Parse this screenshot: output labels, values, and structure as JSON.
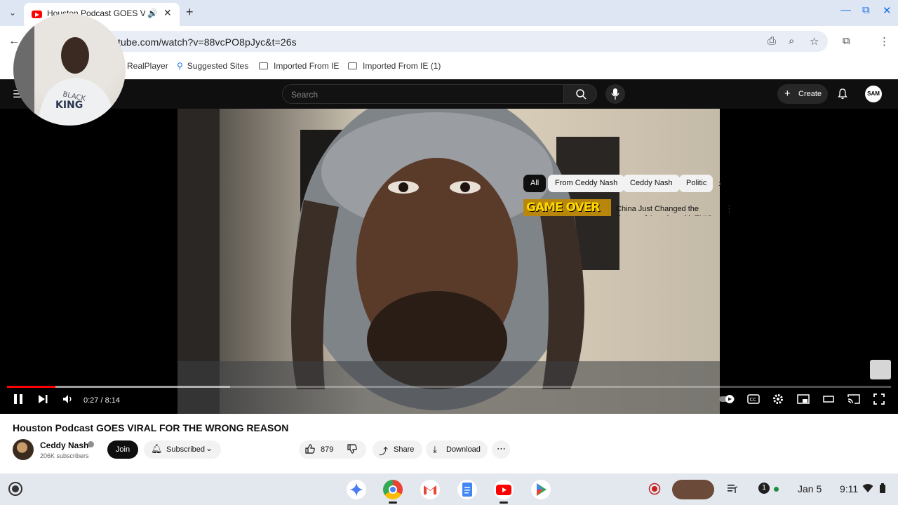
{
  "browser": {
    "tab_title": "Houston Podcast GOES VI",
    "url_prefix": "youtube.com",
    "url_visible": "tube.com/watch?v=88vcPO8pJyc&t=26s",
    "bookmarks": [
      {
        "label": "RealPlayer"
      },
      {
        "label": "Suggested Sites"
      },
      {
        "label": "Imported From IE"
      },
      {
        "label": "Imported From IE (1)"
      }
    ]
  },
  "youtube": {
    "search_placeholder": "Search",
    "create_label": "Create",
    "avatar_text": "SAM",
    "video": {
      "elapsed": "0:27",
      "duration": "8:14",
      "time_display": "0:27 / 8:14",
      "progress_fraction": 0.055
    },
    "title": "Houston Podcast GOES VIRAL FOR THE WRONG REASON",
    "channel": {
      "name": "Ceddy Nash",
      "subscribers": "206K subscribers",
      "join_label": "Join",
      "subscribed_label": "Subscribed"
    },
    "actions": {
      "likes": "879",
      "share_label": "Share",
      "download_label": "Download"
    },
    "chips": [
      "All",
      "From Ceddy Nash",
      "Ceddy Nash",
      "Politic"
    ],
    "recommended": {
      "thumb_text": "GAME OVER",
      "title": "China Just Changed the Future of America with THIS One"
    }
  },
  "shelf": {
    "notification_count": "1",
    "date": "Jan 5",
    "time": "9:11"
  },
  "colors": {
    "youtube_red": "#ff0000",
    "chrome_blue": "#1a73e8",
    "player_bg": "#0f0f0f"
  }
}
